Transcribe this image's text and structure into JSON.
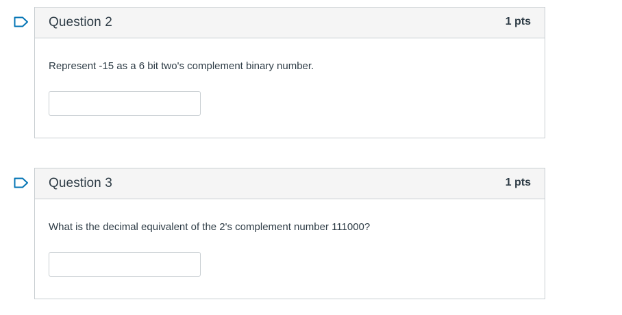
{
  "questions": [
    {
      "title": "Question 2",
      "points": "1 pts",
      "text": "Represent -15 as a 6 bit two's complement binary number.",
      "answer_value": "",
      "flag_icon": "flag-question-icon"
    },
    {
      "title": "Question 3",
      "points": "1 pts",
      "text": "What is the decimal equivalent of the 2's complement number 111000?",
      "answer_value": "",
      "flag_icon": "flag-question-icon"
    }
  ],
  "colors": {
    "flag_accent": "#0374b5",
    "header_bg": "#f5f5f5",
    "border": "#c7cdd1",
    "text": "#2d3b45"
  }
}
